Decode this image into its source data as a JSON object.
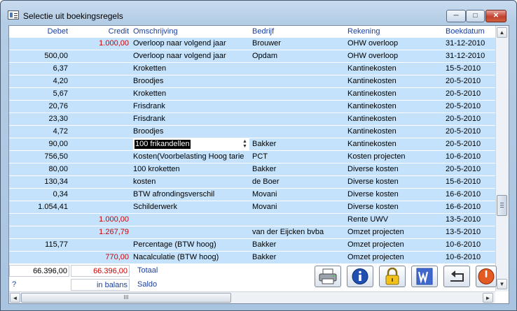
{
  "window": {
    "title": "Selectie uit boekingsregels",
    "minimize": "─",
    "maximize": "□",
    "close": "✕"
  },
  "columns": {
    "debet": "Debet",
    "credit": "Credit",
    "omschrijving": "Omschrijving",
    "bedrijf": "Bedrijf",
    "rekening": "Rekening",
    "boekdatum": "Boekdatum"
  },
  "rows": [
    {
      "debet": "",
      "credit": "1.000,00",
      "omschrijving": "Overloop naar volgend jaar",
      "bedrijf": "Brouwer",
      "rekening": "OHW overloop",
      "boekdatum": "31-12-2010"
    },
    {
      "debet": "500,00",
      "credit": "",
      "omschrijving": "Overloop naar volgend jaar",
      "bedrijf": "Opdam",
      "rekening": "OHW overloop",
      "boekdatum": "31-12-2010"
    },
    {
      "debet": "6,37",
      "credit": "",
      "omschrijving": "Kroketten",
      "bedrijf": "",
      "rekening": "Kantinekosten",
      "boekdatum": "15-5-2010"
    },
    {
      "debet": "4,20",
      "credit": "",
      "omschrijving": "Broodjes",
      "bedrijf": "",
      "rekening": "Kantinekosten",
      "boekdatum": "20-5-2010"
    },
    {
      "debet": "5,67",
      "credit": "",
      "omschrijving": "Kroketten",
      "bedrijf": "",
      "rekening": "Kantinekosten",
      "boekdatum": "20-5-2010"
    },
    {
      "debet": "20,76",
      "credit": "",
      "omschrijving": "Frisdrank",
      "bedrijf": "",
      "rekening": "Kantinekosten",
      "boekdatum": "20-5-2010"
    },
    {
      "debet": "23,30",
      "credit": "",
      "omschrijving": "Frisdrank",
      "bedrijf": "",
      "rekening": "Kantinekosten",
      "boekdatum": "20-5-2010"
    },
    {
      "debet": "4,72",
      "credit": "",
      "omschrijving": "Broodjes",
      "bedrijf": "",
      "rekening": "Kantinekosten",
      "boekdatum": "20-5-2010"
    },
    {
      "debet": "90,00",
      "credit": "",
      "omschrijving": "100 frikandellen",
      "bedrijf": "Bakker",
      "rekening": "Kantinekosten",
      "boekdatum": "20-5-2010",
      "editing": true
    },
    {
      "debet": "756,50",
      "credit": "",
      "omschrijving": "Kosten(Voorbelasting Hoog tarie",
      "bedrijf": "PCT",
      "rekening": "Kosten projecten",
      "boekdatum": "10-6-2010"
    },
    {
      "debet": "80,00",
      "credit": "",
      "omschrijving": "100 kroketten",
      "bedrijf": "Bakker",
      "rekening": "Diverse kosten",
      "boekdatum": "20-5-2010"
    },
    {
      "debet": "130,34",
      "credit": "",
      "omschrijving": "kosten",
      "bedrijf": "de Boer",
      "rekening": "Diverse kosten",
      "boekdatum": "15-6-2010"
    },
    {
      "debet": "0,34",
      "credit": "",
      "omschrijving": "BTW afrondingsverschil",
      "bedrijf": "Movani",
      "rekening": "Diverse kosten",
      "boekdatum": "16-6-2010"
    },
    {
      "debet": "1.054,41",
      "credit": "",
      "omschrijving": "Schilderwerk",
      "bedrijf": "Movani",
      "rekening": "Diverse kosten",
      "boekdatum": "16-6-2010"
    },
    {
      "debet": "",
      "credit": "1.000,00",
      "omschrijving": "",
      "bedrijf": "",
      "rekening": "Rente UWV",
      "boekdatum": "13-5-2010"
    },
    {
      "debet": "",
      "credit": "1.267,79",
      "omschrijving": "",
      "bedrijf": "van der Eijcken bvba",
      "rekening": "Omzet projecten",
      "boekdatum": "13-5-2010"
    },
    {
      "debet": "115,77",
      "credit": "",
      "omschrijving": "Percentage (BTW hoog)",
      "bedrijf": "Bakker",
      "rekening": "Omzet projecten",
      "boekdatum": "10-6-2010"
    },
    {
      "debet": "",
      "credit": "770,00",
      "omschrijving": "Nacalculatie (BTW hoog)",
      "bedrijf": "Bakker",
      "rekening": "Omzet projecten",
      "boekdatum": "10-6-2010"
    }
  ],
  "totals": {
    "debet": "66.396,00",
    "credit": "66.396,00",
    "totaal_label": "Totaal",
    "question": "?",
    "balans_text": "in balans",
    "saldo_label": "Saldo"
  },
  "toolbar": {
    "buttons": [
      "printer-icon",
      "info-icon",
      "lock-icon",
      "word-icon",
      "undo-icon",
      "power-icon"
    ]
  },
  "scroll": {
    "up": "▲",
    "down": "▼",
    "left": "◄",
    "right": "►",
    "grip": "III"
  },
  "colors": {
    "row_bg": "#c4e2fb",
    "credit_red": "#d10000",
    "header_blue": "#1a3fa0"
  }
}
